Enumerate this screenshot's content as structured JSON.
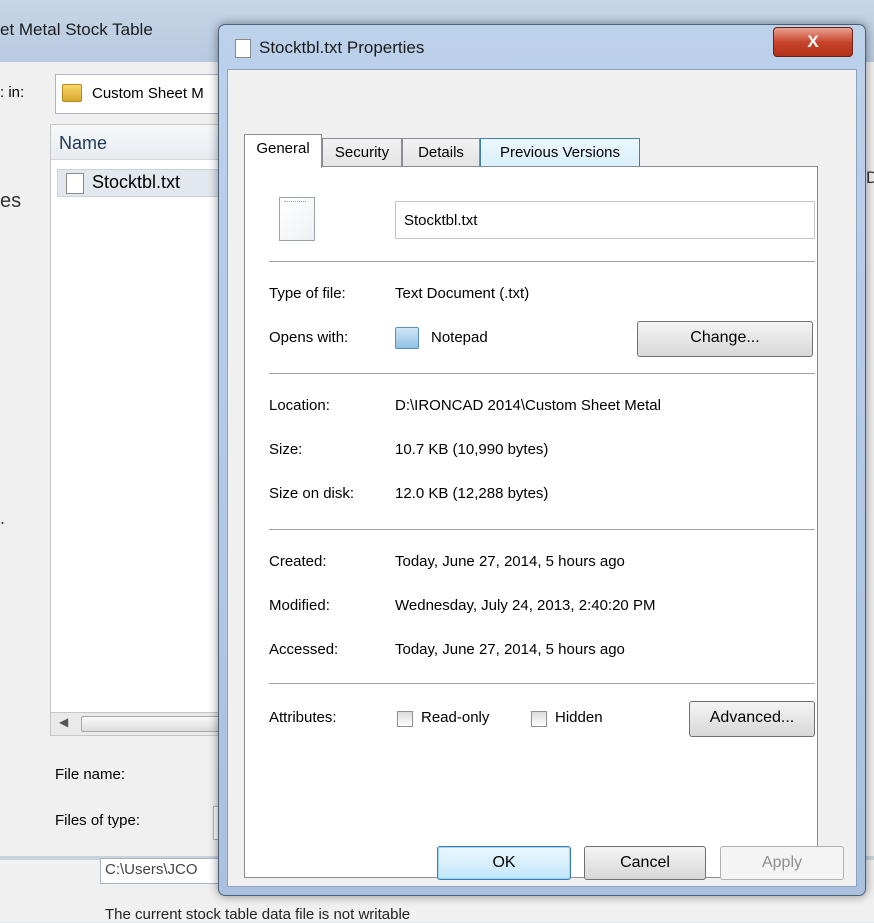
{
  "background_window": {
    "title": "et Metal Stock Table",
    "look_in_label": ": in:",
    "folder": "Custom Sheet M",
    "column_name": "Name",
    "file": "Stocktbl.txt",
    "sidebar_fragment": "es",
    "filename_label": "File name:",
    "filetype_label": "Files of type:",
    "path_fragment": "C:\\Users\\JCO",
    "status_text": "The current stock table data file is not writable",
    "right_edge_fragment": "D"
  },
  "dialog": {
    "title": "Stocktbl.txt Properties",
    "close_label": "X",
    "tabs": [
      {
        "label": "General",
        "active": true
      },
      {
        "label": "Security",
        "active": false
      },
      {
        "label": "Details",
        "active": false
      },
      {
        "label": "Previous Versions",
        "active": false
      }
    ],
    "file_name": "Stocktbl.txt",
    "type_of_file_label": "Type of file:",
    "type_of_file": "Text Document (.txt)",
    "opens_with_label": "Opens with:",
    "opens_with": "Notepad",
    "change_button": "Change...",
    "location_label": "Location:",
    "location": "D:\\IRONCAD 2014\\Custom Sheet Metal",
    "size_label": "Size:",
    "size": "10.7 KB (10,990 bytes)",
    "size_on_disk_label": "Size on disk:",
    "size_on_disk": "12.0 KB (12,288 bytes)",
    "created_label": "Created:",
    "created": "Today, June 27, 2014, 5 hours ago",
    "modified_label": "Modified:",
    "modified": "Wednesday, July 24, 2013, 2:40:20 PM",
    "accessed_label": "Accessed:",
    "accessed": "Today, June 27, 2014, 5 hours ago",
    "attributes_label": "Attributes:",
    "readonly_label": "Read-only",
    "readonly_checked": false,
    "hidden_label": "Hidden",
    "hidden_checked": false,
    "advanced_button": "Advanced...",
    "ok_button": "OK",
    "cancel_button": "Cancel",
    "apply_button": "Apply"
  }
}
